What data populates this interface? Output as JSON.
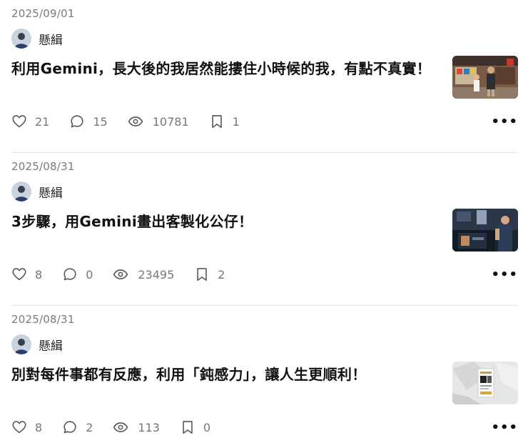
{
  "posts": [
    {
      "date": "2025/09/01",
      "author": "懸緝",
      "title": "利用Gemini，長大後的我居然能摟住小時候的我，有點不真實！",
      "likes": "21",
      "comments": "15",
      "views": "10781",
      "bookmarks": "1"
    },
    {
      "date": "2025/08/31",
      "author": "懸緝",
      "title": "3步驟，用Gemini畫出客製化公仔！",
      "likes": "8",
      "comments": "0",
      "views": "23495",
      "bookmarks": "2"
    },
    {
      "date": "2025/08/31",
      "author": "懸緝",
      "title": "別對每件事都有反應，利用「鈍感力」，讓人生更順利！",
      "likes": "8",
      "comments": "2",
      "views": "113",
      "bookmarks": "0"
    }
  ],
  "icons": {
    "like": "heart-icon",
    "comment": "comment-bubble-icon",
    "views": "eye-icon",
    "bookmark": "bookmark-icon",
    "more": "more-dots-icon"
  },
  "more_label": "•••",
  "colors": {
    "text": "#111111",
    "muted": "#777777",
    "divider": "#e4e4e4"
  }
}
